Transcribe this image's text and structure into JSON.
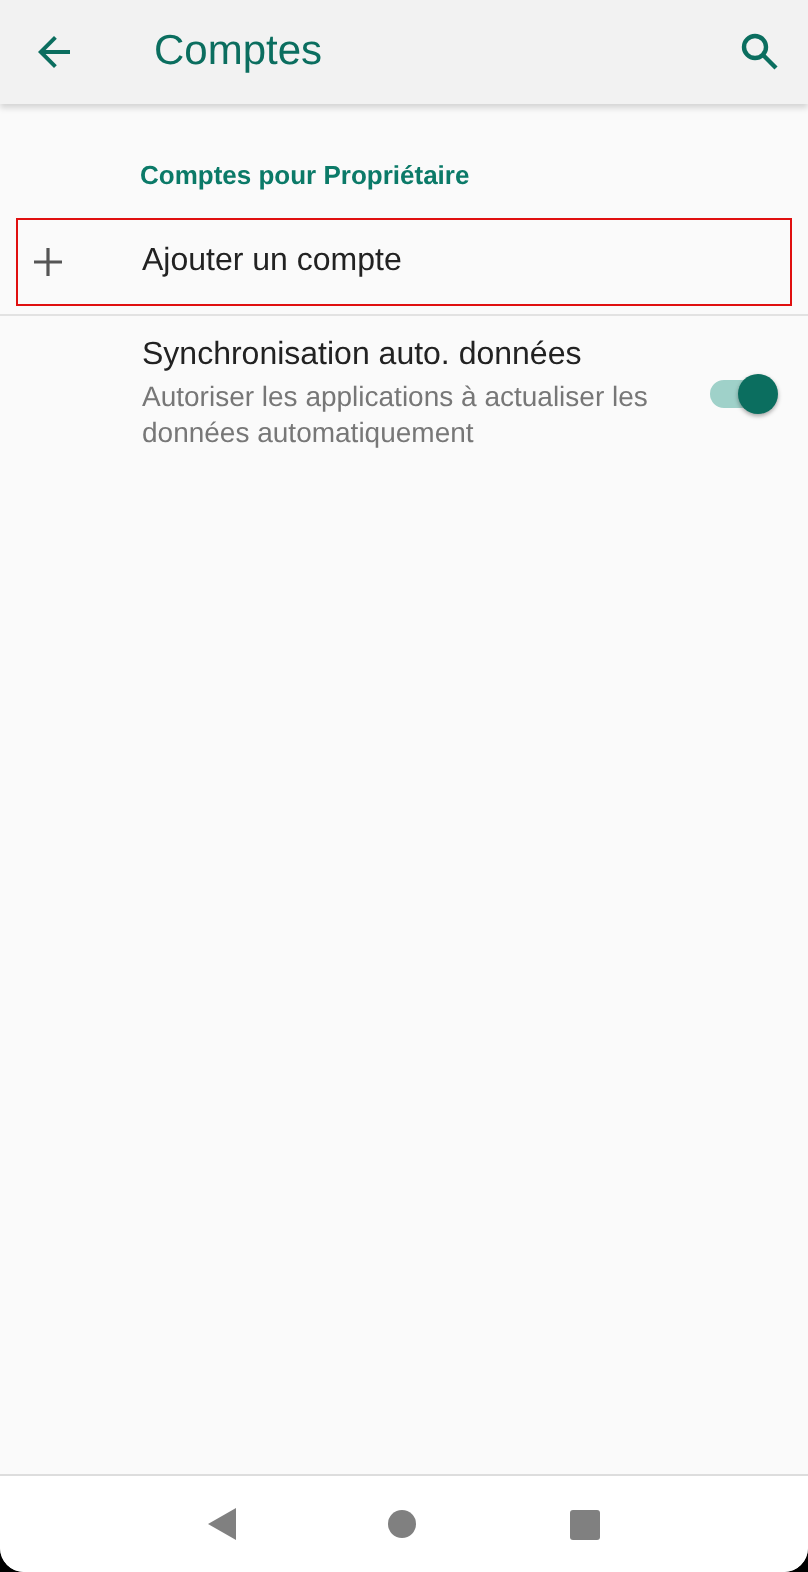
{
  "app_bar": {
    "title": "Comptes"
  },
  "section": {
    "title": "Comptes pour Propriétaire"
  },
  "items": [
    {
      "kind": "action",
      "title": "Ajouter un compte",
      "highlighted": true
    },
    {
      "kind": "switch",
      "title": "Synchronisation auto. données",
      "summary": "Autoriser les applications à actualiser les données automatiquement",
      "on": true,
      "highlighted": false
    }
  ]
}
